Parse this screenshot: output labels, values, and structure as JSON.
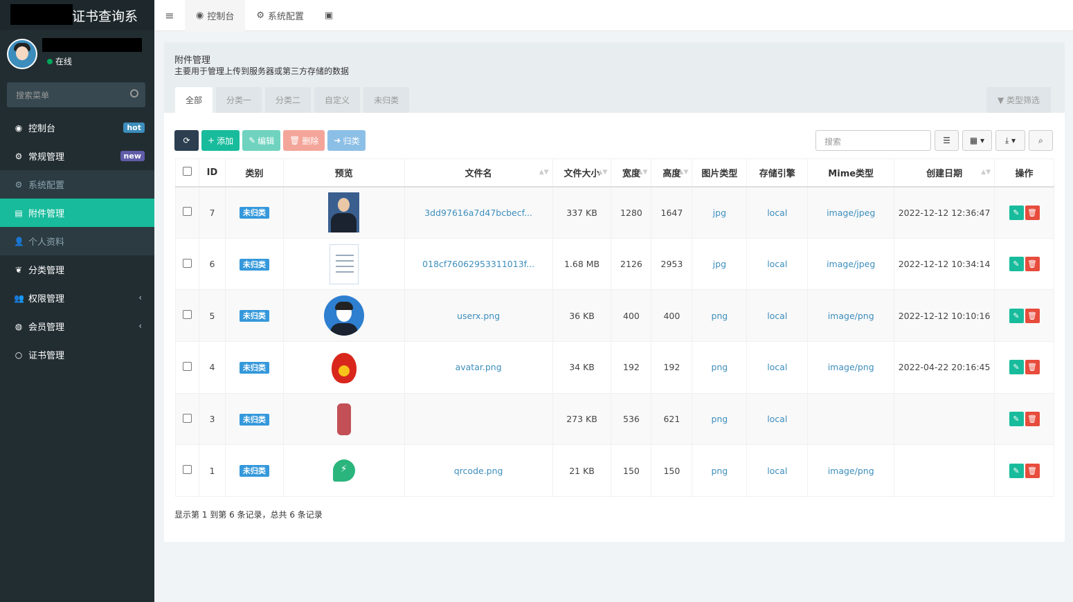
{
  "sidebar": {
    "logo": "证书查询系",
    "status": "在线",
    "search_placeholder": "搜索菜单",
    "items": [
      {
        "label": "控制台",
        "icon": "dashboard-icon",
        "glyph": "◉",
        "badge": "hot"
      },
      {
        "label": "常规管理",
        "icon": "cogs-icon",
        "glyph": "⚙",
        "badge": "new"
      },
      {
        "label": "系统配置",
        "icon": "gear-icon",
        "glyph": "⚙"
      },
      {
        "label": "附件管理",
        "icon": "file-image-icon",
        "glyph": "▤"
      },
      {
        "label": "个人资料",
        "icon": "user-icon",
        "glyph": "👤"
      },
      {
        "label": "分类管理",
        "icon": "leaf-icon",
        "glyph": "❦"
      },
      {
        "label": "权限管理",
        "icon": "group-icon",
        "glyph": "👥"
      },
      {
        "label": "会员管理",
        "icon": "user-circle-icon",
        "glyph": "◍"
      },
      {
        "label": "证书管理",
        "icon": "circle-icon",
        "glyph": "○"
      }
    ]
  },
  "topnav": {
    "tabs": [
      {
        "label": "控制台",
        "glyph": "◉"
      },
      {
        "label": "系统配置",
        "glyph": "⚙"
      }
    ]
  },
  "panel": {
    "title": "附件管理",
    "description": "主要用于管理上传到服务器或第三方存储的数据",
    "tabs": [
      "全部",
      "分类一",
      "分类二",
      "自定义",
      "未归类"
    ],
    "filter_label": "类型筛选"
  },
  "toolbar": {
    "add": "添加",
    "edit": "编辑",
    "delete": "删除",
    "classify": "归类",
    "search_placeholder": "搜索"
  },
  "table": {
    "headers": [
      "ID",
      "类别",
      "预览",
      "文件名",
      "文件大小",
      "宽度",
      "高度",
      "图片类型",
      "存储引擎",
      "Mime类型",
      "创建日期",
      "操作"
    ],
    "rows": [
      {
        "id": "7",
        "category": "未归类",
        "thumb": "photo",
        "filename": "3dd97616a7d47bcbecf...",
        "size": "337 KB",
        "width": "1280",
        "height": "1647",
        "imgtype": "jpg",
        "storage": "local",
        "mime": "image/jpeg",
        "date": "2022-12-12 12:36:47"
      },
      {
        "id": "6",
        "category": "未归类",
        "thumb": "cert",
        "filename": "018cf76062953311013f...",
        "size": "1.68 MB",
        "width": "2126",
        "height": "2953",
        "imgtype": "jpg",
        "storage": "local",
        "mime": "image/jpeg",
        "date": "2022-12-12 10:34:14"
      },
      {
        "id": "5",
        "category": "未归类",
        "thumb": "userx",
        "filename": "userx.png",
        "size": "36 KB",
        "width": "400",
        "height": "400",
        "imgtype": "png",
        "storage": "local",
        "mime": "image/png",
        "date": "2022-12-12 10:10:16"
      },
      {
        "id": "4",
        "category": "未归类",
        "thumb": "fire",
        "filename": "avatar.png",
        "size": "34 KB",
        "width": "192",
        "height": "192",
        "imgtype": "png",
        "storage": "local",
        "mime": "image/png",
        "date": "2022-04-22 20:16:45"
      },
      {
        "id": "3",
        "category": "未归类",
        "thumb": "art",
        "filename": "",
        "size": "273 KB",
        "width": "536",
        "height": "621",
        "imgtype": "png",
        "storage": "local",
        "mime": "",
        "date": ""
      },
      {
        "id": "1",
        "category": "未归类",
        "thumb": "qr",
        "filename": "qrcode.png",
        "size": "21 KB",
        "width": "150",
        "height": "150",
        "imgtype": "png",
        "storage": "local",
        "mime": "image/png",
        "date": ""
      }
    ]
  },
  "footer": "显示第 1 到第 6 条记录，总共 6 条记录"
}
